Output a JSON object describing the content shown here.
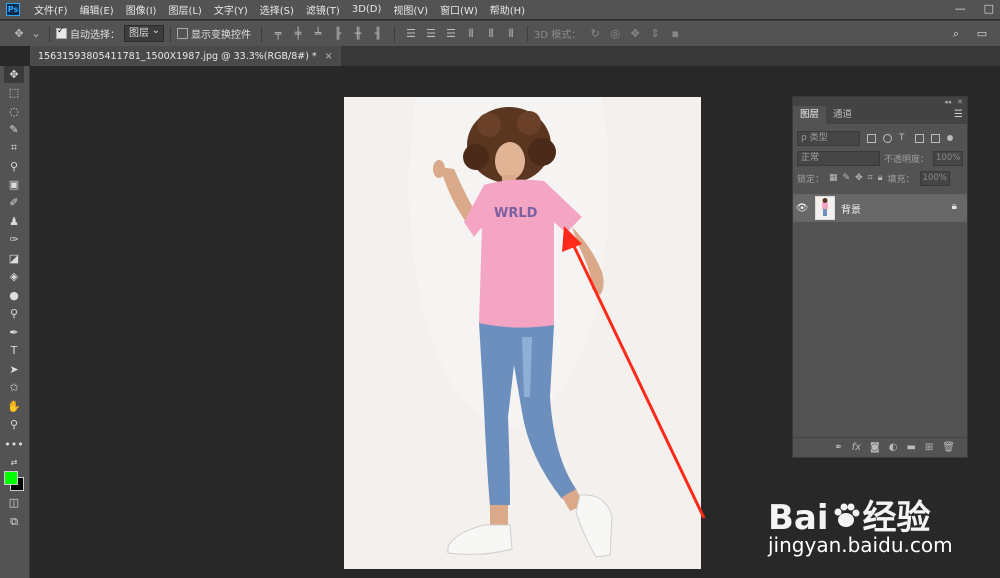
{
  "app": {
    "logo": "Ps"
  },
  "menu": [
    "文件(F)",
    "编辑(E)",
    "图像(I)",
    "图层(L)",
    "文字(Y)",
    "选择(S)",
    "滤镜(T)",
    "3D(D)",
    "视图(V)",
    "窗口(W)",
    "帮助(H)"
  ],
  "window_buttons": [
    "—",
    "□"
  ],
  "options_bar": {
    "auto_select_label": "自动选择：",
    "auto_select_checked": true,
    "auto_select_target": "图层",
    "show_transform_label": "显示变换控件",
    "show_transform_checked": false,
    "mode_3d_label": "3D 模式："
  },
  "document_tab": {
    "title": "15631593805411781_1500X1987.jpg @ 33.3%(RGB/8#) *",
    "close": "×"
  },
  "colors": {
    "foreground": "#00ff00",
    "background": "#000000",
    "annotation_arrow": "#ff2a1a"
  },
  "layers_panel": {
    "tabs": [
      "图层",
      "通道"
    ],
    "active_tab": 0,
    "filter_placeholder": "ρ 类型",
    "blend_mode": "正常",
    "opacity_label": "不透明度：",
    "opacity_value": "100%",
    "lock_label": "锁定：",
    "fill_label": "填充：",
    "fill_value": "100%",
    "layers": [
      {
        "name": "背景",
        "visible": true,
        "locked": true
      }
    ]
  },
  "watermark": {
    "brand": "Bai",
    "brand2": "经验",
    "url": "jingyan.baidu.com"
  }
}
